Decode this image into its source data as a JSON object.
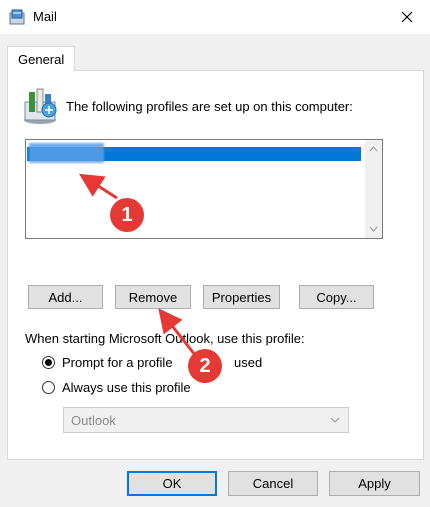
{
  "window": {
    "title": "Mail"
  },
  "tabs": [
    {
      "label": "General"
    }
  ],
  "profiles_label": "The following profiles are set up on this computer:",
  "buttons": {
    "add": "Add...",
    "remove": "Remove",
    "properties": "Properties",
    "copy": "Copy..."
  },
  "startup": {
    "label": "When starting Microsoft Outlook, use this profile:",
    "prompt_label": "Prompt for a profile",
    "prompt_label_tail": "used",
    "always_label": "Always use this profile",
    "selected_option": "prompt",
    "combo_value": "Outlook"
  },
  "footer": {
    "ok": "OK",
    "cancel": "Cancel",
    "apply": "Apply"
  },
  "annotations": [
    {
      "number": "1"
    },
    {
      "number": "2"
    }
  ],
  "colors": {
    "selection": "#0078d7",
    "annotation": "#e53935",
    "default_button_border": "#0078d7"
  },
  "icons": {
    "app": "mail-app-icon",
    "profile": "mail-profile-icon",
    "close": "close-icon"
  }
}
